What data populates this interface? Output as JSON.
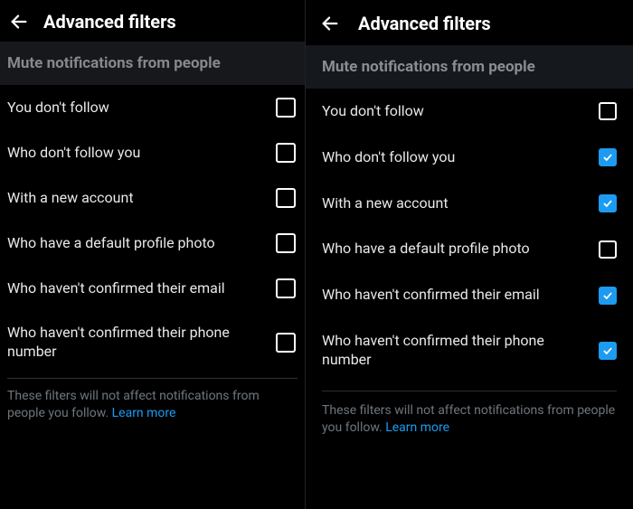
{
  "left": {
    "title": "Advanced filters",
    "section": "Mute notifications from people",
    "items": [
      {
        "label": "You don't follow",
        "checked": false
      },
      {
        "label": "Who don't follow you",
        "checked": false
      },
      {
        "label": "With a new account",
        "checked": false
      },
      {
        "label": "Who have a default profile photo",
        "checked": false
      },
      {
        "label": "Who haven't confirmed their email",
        "checked": false
      },
      {
        "label": "Who haven't confirmed their phone number",
        "checked": false
      }
    ],
    "footer_text": "These filters will not affect notifications from people you follow. ",
    "learn_more": "Learn more"
  },
  "right": {
    "title": "Advanced filters",
    "section": "Mute notifications from people",
    "items": [
      {
        "label": "You don't follow",
        "checked": false
      },
      {
        "label": "Who don't follow you",
        "checked": true
      },
      {
        "label": "With a new account",
        "checked": true
      },
      {
        "label": "Who have a default profile photo",
        "checked": false
      },
      {
        "label": "Who haven't confirmed their email",
        "checked": true
      },
      {
        "label": "Who haven't confirmed their phone number",
        "checked": true
      }
    ],
    "footer_text": "These filters will not affect notifications from people you follow. ",
    "learn_more": "Learn more"
  },
  "colors": {
    "accent": "#1d9bf0",
    "bg": "#000000"
  }
}
